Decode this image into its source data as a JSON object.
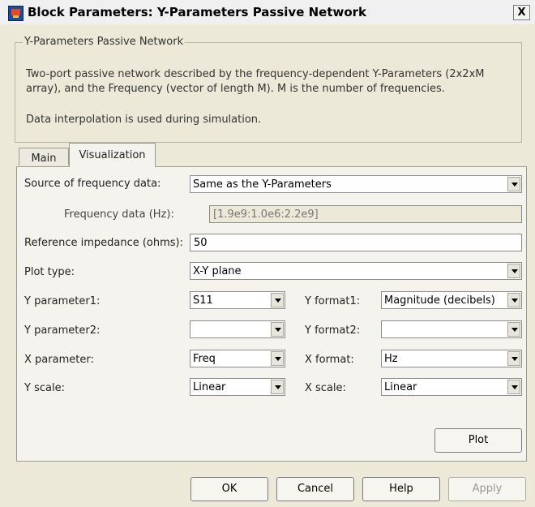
{
  "window": {
    "title": "Block Parameters: Y-Parameters Passive Network",
    "close_label": "X"
  },
  "group": {
    "legend": "Y-Parameters Passive Network",
    "description": "Two-port passive network described by the frequency-dependent Y-Parameters (2x2xM array), and the Frequency (vector of length M).  M is the number of frequencies.",
    "interpolation_note": "Data interpolation is used during simulation."
  },
  "tabs": [
    {
      "label": "Main"
    },
    {
      "label": "Visualization"
    }
  ],
  "visualization": {
    "source_label": "Source of frequency data:",
    "source_value": "Same as the Y-Parameters",
    "freq_label": "Frequency data (Hz):",
    "freq_value": "[1.9e9:1.0e6:2.2e9]",
    "ref_label": "Reference impedance (ohms):",
    "ref_value": "50",
    "plot_type_label": "Plot type:",
    "plot_type_value": "X-Y plane",
    "yparam1_label": "Y parameter1:",
    "yparam1_value": "S11",
    "yformat1_label": "Y format1:",
    "yformat1_value": "Magnitude (decibels)",
    "yparam2_label": "Y parameter2:",
    "yparam2_value": "",
    "yformat2_label": "Y format2:",
    "yformat2_value": "",
    "xparam_label": "X parameter:",
    "xparam_value": "Freq",
    "xformat_label": "X format:",
    "xformat_value": "Hz",
    "yscale_label": "Y scale:",
    "yscale_value": "Linear",
    "xscale_label": "X scale:",
    "xscale_value": "Linear",
    "plot_button": "Plot"
  },
  "buttons": {
    "ok": "OK",
    "cancel": "Cancel",
    "help": "Help",
    "apply": "Apply"
  }
}
